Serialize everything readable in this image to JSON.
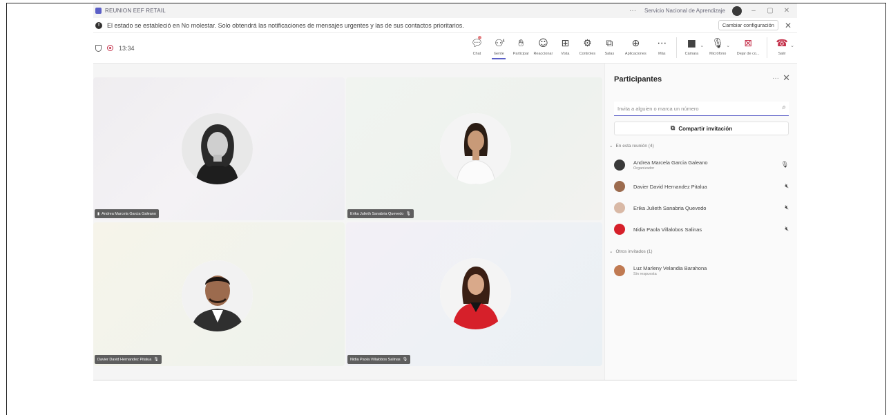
{
  "window": {
    "title": "REUNION EEF RETAIL",
    "org": "Servicio Nacional de Aprendizaje"
  },
  "banner": {
    "text": "El estado se estableció en No molestar. Solo obtendrá las notificaciones de mensajes urgentes y las de sus contactos prioritarios.",
    "button": "Cambiar configuración"
  },
  "toolbar": {
    "timer": "13:34",
    "people_count": "4",
    "buttons": {
      "chat": "Chat",
      "people": "Gente",
      "raise": "Participar",
      "react": "Reaccionar",
      "view": "Vista",
      "controls": "Controles",
      "rooms": "Salas",
      "apps": "Aplicaciones",
      "more": "Más",
      "camera": "Cámara",
      "mic": "Micrófono",
      "share": "Dejar de co...",
      "leave": "Salir"
    }
  },
  "tiles": [
    {
      "name": "Andrea Marcela Garcia Galeano"
    },
    {
      "name": "Erika Julieth Sanabria Quevedo"
    },
    {
      "name": "Davier David Hernandez Pitalua"
    },
    {
      "name": "Nidia Paola Villalobos Salinas"
    }
  ],
  "panel": {
    "title": "Participantes",
    "invite_placeholder": "Invita a alguien o marca un número",
    "share_invite": "Compartir invitación",
    "in_meeting_label": "En esta reunión (4)",
    "others_label": "Otros invitados (1)",
    "in_meeting": [
      {
        "name": "Andrea Marcela Garcia Galeano",
        "role": "Organizador",
        "mic": "on"
      },
      {
        "name": "Davier David Hernandez Pitalua",
        "role": "",
        "mic": "off"
      },
      {
        "name": "Erika Julieth Sanabria Quevedo",
        "role": "",
        "mic": "off"
      },
      {
        "name": "Nidia Paola Villalobos Salinas",
        "role": "",
        "mic": "off"
      }
    ],
    "others": [
      {
        "name": "Luz Marleny Velandia Barahona",
        "status": "Sin respuesta"
      }
    ]
  },
  "colors": {
    "accent": "#5b5fc7",
    "leave": "#c4314b",
    "name_tag": "#5e5e5e"
  }
}
